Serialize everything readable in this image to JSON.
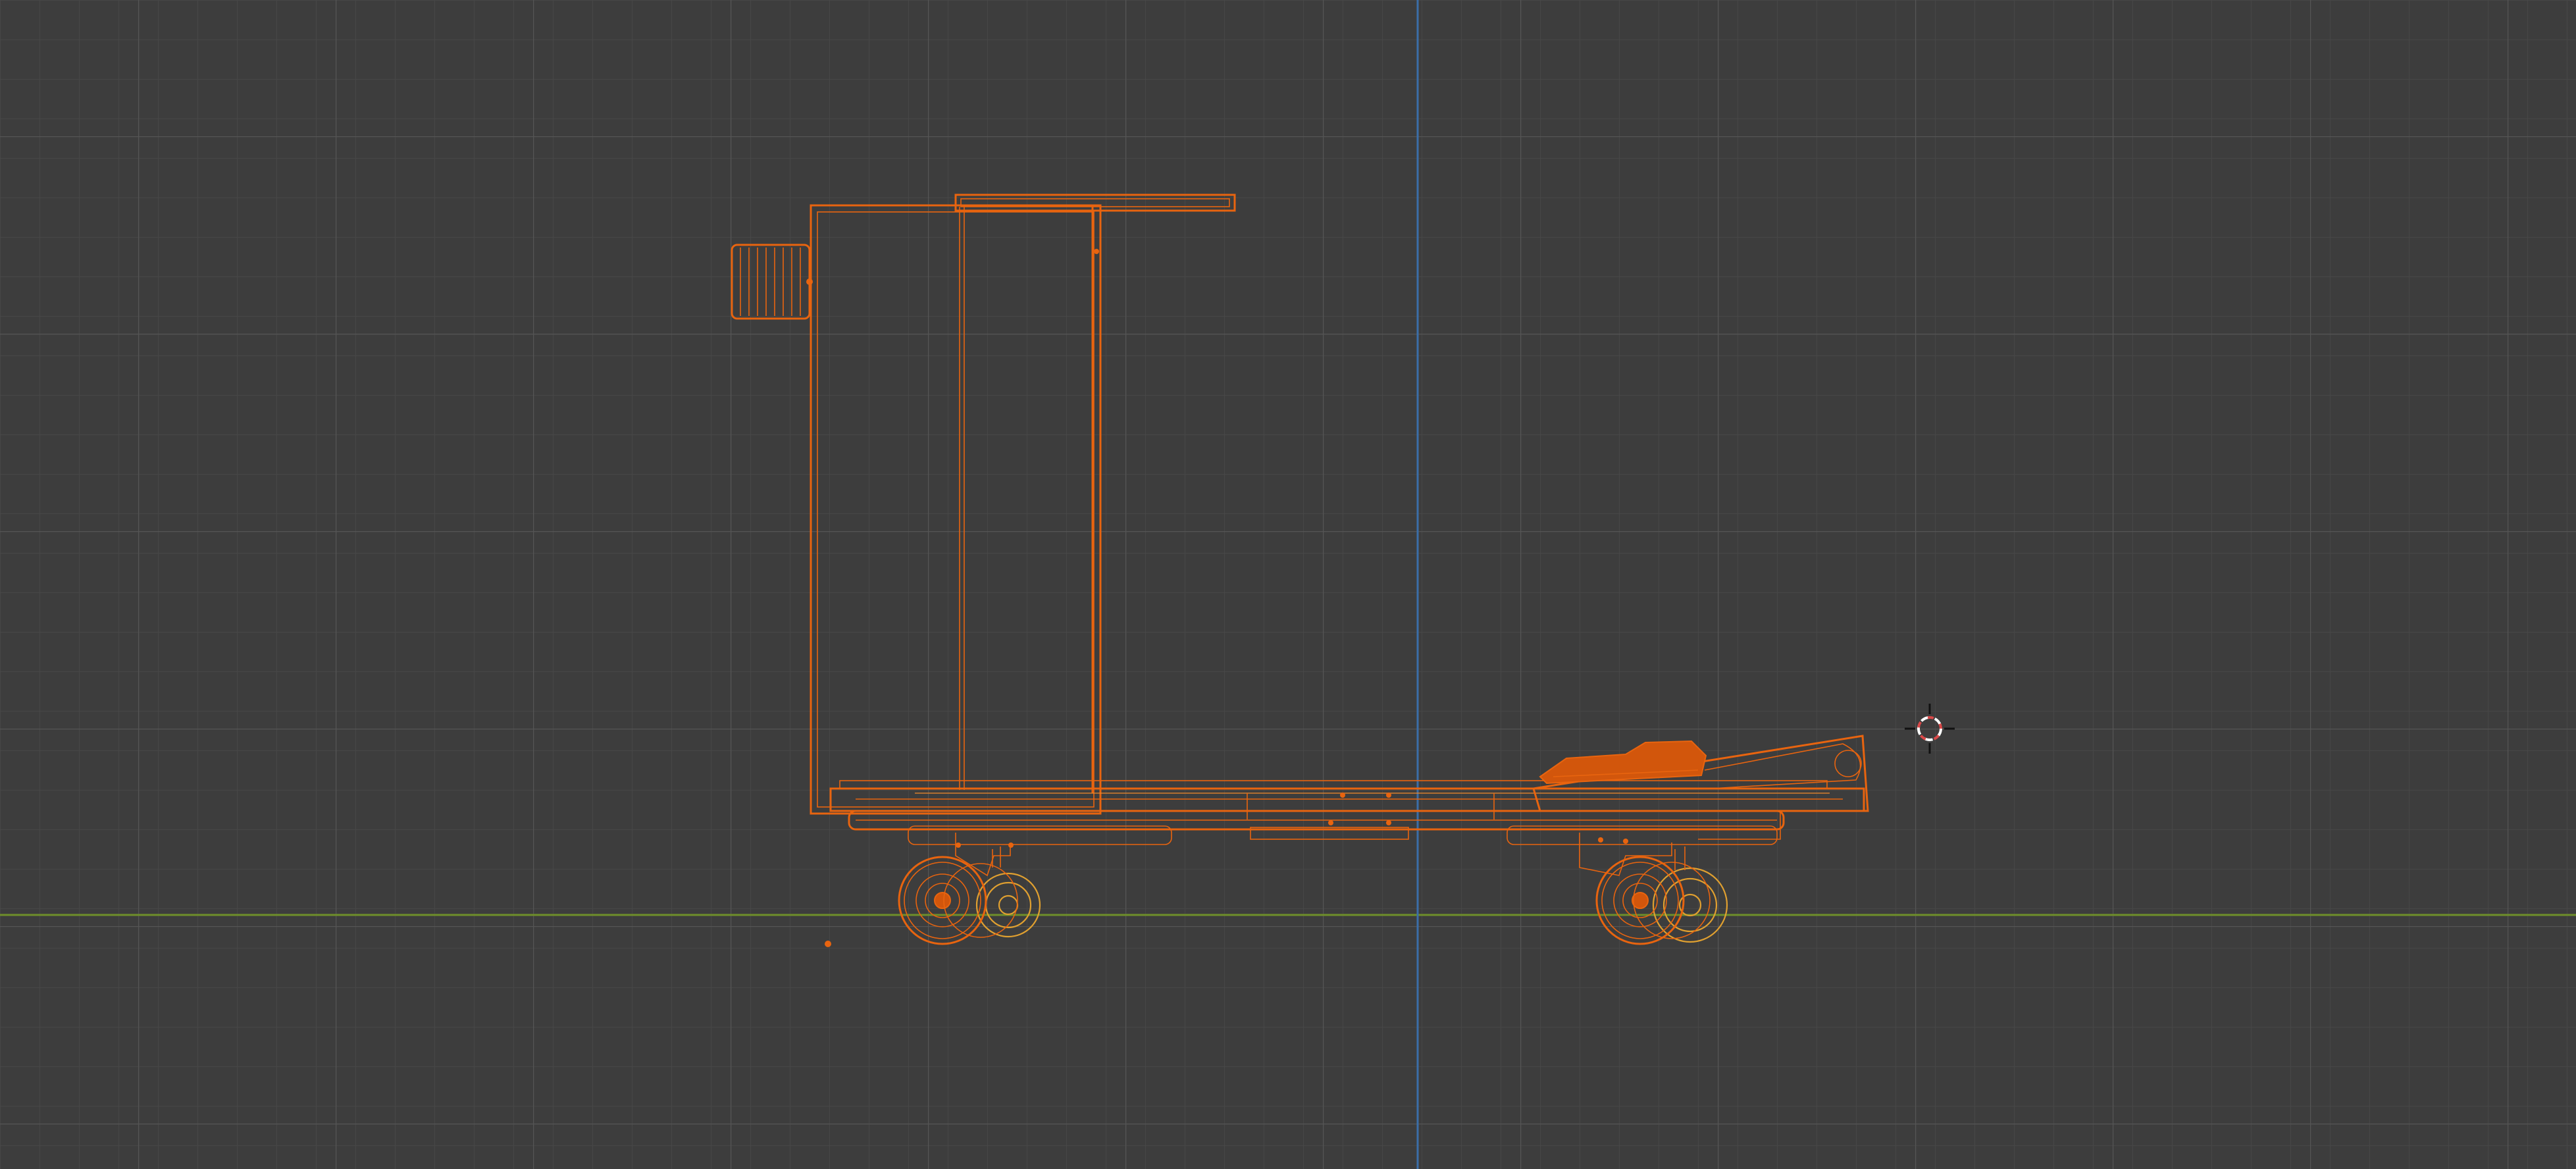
{
  "viewport": {
    "mode": "wireframe-side-view",
    "colors": {
      "background": "#3d3d3d",
      "grid_minor": "#474747",
      "grid_major": "#515151",
      "x_axis": "#6e8f2a",
      "z_axis": "#3b6ea8",
      "selection": "#e8640f",
      "selection_secondary": "#e0a030",
      "cursor_red": "#d94848",
      "cursor_white": "#ffffff"
    },
    "objects": [
      {
        "name": "cart-frame",
        "selected": true
      },
      {
        "name": "back-panel",
        "selected": true
      },
      {
        "name": "handle",
        "selected": true
      },
      {
        "name": "front-wheel",
        "selected": true
      },
      {
        "name": "rear-wheel",
        "selected": true
      },
      {
        "name": "seat",
        "selected": true
      },
      {
        "name": "origin-dot",
        "selected": true
      }
    ],
    "cursor_3d": {
      "icon": "3d-cursor-icon"
    }
  }
}
